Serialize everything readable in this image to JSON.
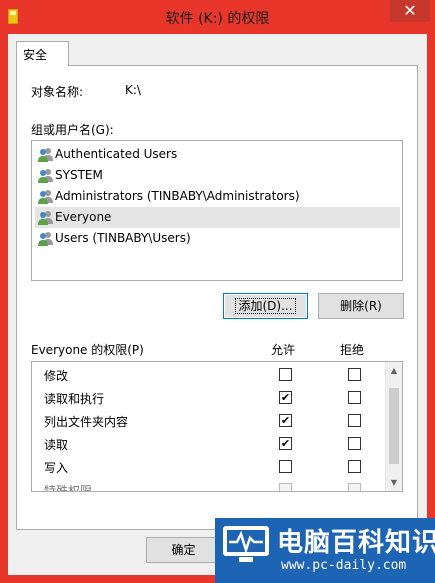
{
  "window": {
    "title": "软件 (K:) 的权限",
    "close_glyph": "✕"
  },
  "tabs": [
    {
      "label": "安全",
      "selected": true
    }
  ],
  "object": {
    "label": "对象名称:",
    "value": "K:\\"
  },
  "groups": {
    "label": "组或用户名(G):",
    "selected_index": 3,
    "items": [
      {
        "name": "Authenticated Users",
        "icon": "user-group-icon"
      },
      {
        "name": "SYSTEM",
        "icon": "user-group-icon"
      },
      {
        "name": "Administrators (TINBABY\\Administrators)",
        "icon": "user-group-icon"
      },
      {
        "name": "Everyone",
        "icon": "user-group-icon"
      },
      {
        "name": "Users (TINBABY\\Users)",
        "icon": "user-group-icon"
      }
    ]
  },
  "buttons": {
    "add": "添加(D)...",
    "remove": "删除(R)",
    "ok": "确定"
  },
  "permissions": {
    "label": "Everyone 的权限(P)",
    "allow_header": "允许",
    "deny_header": "拒绝",
    "rows": [
      {
        "name": "修改",
        "allow": false,
        "deny": false
      },
      {
        "name": "读取和执行",
        "allow": true,
        "deny": false
      },
      {
        "name": "列出文件夹内容",
        "allow": true,
        "deny": false
      },
      {
        "name": "读取",
        "allow": true,
        "deny": false
      },
      {
        "name": "写入",
        "allow": false,
        "deny": false
      },
      {
        "name": "特殊权限",
        "allow": false,
        "deny": false
      }
    ]
  },
  "watermark": {
    "title": "电脑百科知识",
    "url": "www.pc-daily.com"
  },
  "colors": {
    "titlebar": "#e8372a",
    "close_button": "#c7382c",
    "selection": "#e5e5e5",
    "focus_border": "#0078d7",
    "watermark_bg": "#1e64b4"
  }
}
